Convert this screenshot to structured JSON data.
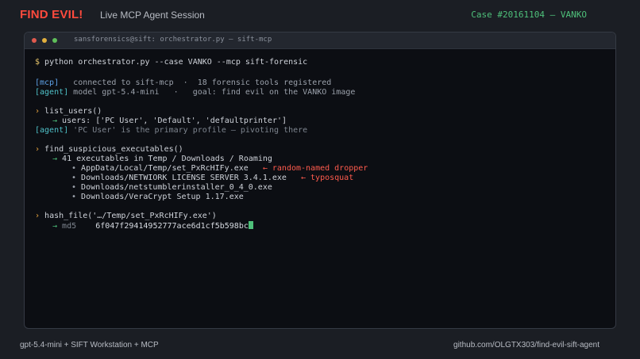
{
  "header": {
    "brand": "FIND EVIL!",
    "session": "Live MCP Agent Session",
    "case": "Case #20161104 — VANKO"
  },
  "window": {
    "title": "sansforensics@sift: orchestrator.py — sift-mcp"
  },
  "terminal": {
    "command_prompt": "$",
    "command": " python orchestrator.py --case VANKO --mcp sift-forensic",
    "mcp_tag": "[mcp]",
    "mcp_text": "   connected to sift-mcp  ·  18 forensic tools registered",
    "agent_tag": "[agent]",
    "agent_model_text": " model gpt-5.4-mini   ·   goal: find evil on the VANKO image",
    "call1_chevron": "›",
    "call1": " list_users()",
    "call1_arrow": "→",
    "call1_result": " users: ['PC User', 'Default', 'defaultprinter']",
    "agent_note": " 'PC User' is the primary profile — pivoting there",
    "call2_chevron": "›",
    "call2": " find_suspicious_executables()",
    "call2_arrow": "→",
    "call2_result": " 41 executables in Temp / Downloads / Roaming",
    "bullet": "•",
    "files": [
      {
        "path": " AppData/Local/Temp/set_PxRcHIFy.exe",
        "note": "   ← random-named dropper"
      },
      {
        "path": " Downloads/NETWIORK LICENSE SERVER 3.4.1.exe",
        "note": "   ← typosquat"
      },
      {
        "path": " Downloads/netstumblerinstaller_0_4_0.exe",
        "note": ""
      },
      {
        "path": " Downloads/VeraCrypt Setup 1.17.exe",
        "note": ""
      }
    ],
    "call3_chevron": "›",
    "call3": " hash_file('…/Temp/set_PxRcHIFy.exe')",
    "call3_arrow": "→",
    "hash_label": " md5",
    "hash_value": "    6f047f29414952777ace6d1cf5b598bc"
  },
  "footer": {
    "left": "gpt-5.4-mini  +  SIFT Workstation  +  MCP",
    "right": "github.com/OLGTX303/find-evil-sift-agent"
  },
  "colors": {
    "brand": "#ff4a3d",
    "case": "#4ec07a",
    "mcp_tag": "#5ea2e8",
    "agent_tag": "#4fc1c8",
    "warning": "#ff5b4d",
    "arrow": "#4ec07a",
    "chevron": "#e7a33e",
    "prompt": "#e8c66a",
    "cursor": "#4ec07a"
  }
}
